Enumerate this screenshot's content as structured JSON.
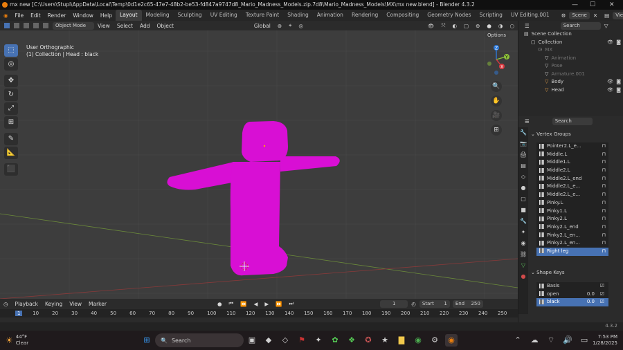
{
  "window": {
    "title": "mx new [C:\\Users\\Stupi\\AppData\\Local\\Temp\\0d1e2c65-47e7-48b2-be53-fd847a9747d8_Mario_Madness_Models.zip.7d8\\Mario_Madness_Models\\MX\\mx new.blend] - Blender 4.3.2",
    "minimize": "—",
    "maximize": "☐",
    "close": "✕"
  },
  "menu": [
    "File",
    "Edit",
    "Render",
    "Window",
    "Help"
  ],
  "workspaces": [
    "Layout",
    "Modeling",
    "Sculpting",
    "UV Editing",
    "Texture Paint",
    "Shading",
    "Animation",
    "Rendering",
    "Compositing",
    "Geometry Nodes",
    "Scripting",
    "UV Editing.001"
  ],
  "scene_label": "Scene",
  "viewlayer_label": "ViewLayer",
  "viewport_header": {
    "mode": "Object Mode",
    "menus": [
      "View",
      "Select",
      "Add",
      "Object"
    ],
    "transform": "Global",
    "options": "Options"
  },
  "viewport_info": {
    "line1": "User Orthographic",
    "line2": "(1) Collection | Head : black"
  },
  "gizmo": {
    "z": "Z",
    "y": "Y",
    "x": "X"
  },
  "outliner": {
    "search_placeholder": "Search",
    "items": [
      {
        "label": "Scene Collection",
        "indent": 0
      },
      {
        "label": "Collection",
        "indent": 1
      },
      {
        "label": "MX",
        "indent": 2
      },
      {
        "label": "Animation",
        "indent": 3
      },
      {
        "label": "Pose",
        "indent": 3
      },
      {
        "label": "Armature.001",
        "indent": 3
      },
      {
        "label": "Body",
        "indent": 3
      },
      {
        "label": "Head",
        "indent": 3
      }
    ]
  },
  "props": {
    "search_placeholder": "Search",
    "vertex_groups_title": "Vertex Groups",
    "vertex_groups": [
      "Pointer2.L_e...",
      "Middle.L",
      "Middle1.L",
      "Middle2.L",
      "Middle2.L_end",
      "Middle2.L_e...",
      "Middle2.L_e...",
      "Pinky.L",
      "Pinky1.L",
      "Pinky2.L",
      "Pinky2.L_end",
      "Pinky2.L_en...",
      "Pinky2.L_en...",
      "Right leg"
    ],
    "shape_keys_title": "Shape Keys",
    "shape_keys": [
      {
        "name": "Basis",
        "value": ""
      },
      {
        "name": "open",
        "value": "0.0"
      },
      {
        "name": "black",
        "value": "0.0"
      }
    ]
  },
  "timeline": {
    "menus": [
      "Playback",
      "Keying",
      "View",
      "Marker"
    ],
    "current_frame": "1",
    "start_label": "Start",
    "start": "1",
    "end_label": "End",
    "end": "250",
    "ticks": [
      "1",
      "10",
      "20",
      "30",
      "40",
      "50",
      "60",
      "70",
      "80",
      "90",
      "100",
      "110",
      "120",
      "130",
      "140",
      "150",
      "160",
      "170",
      "180",
      "190",
      "200",
      "210",
      "220",
      "230",
      "240",
      "250"
    ]
  },
  "status": {
    "version": "4.3.2"
  },
  "taskbar": {
    "weather_temp": "44°F",
    "weather_desc": "Clear",
    "search": "Search",
    "time": "7:53 PM",
    "date": "1/28/2025"
  },
  "colors": {
    "mesh": "#d80fd4",
    "accent": "#4772b3",
    "viewport_bg": "#3d3d3d"
  }
}
